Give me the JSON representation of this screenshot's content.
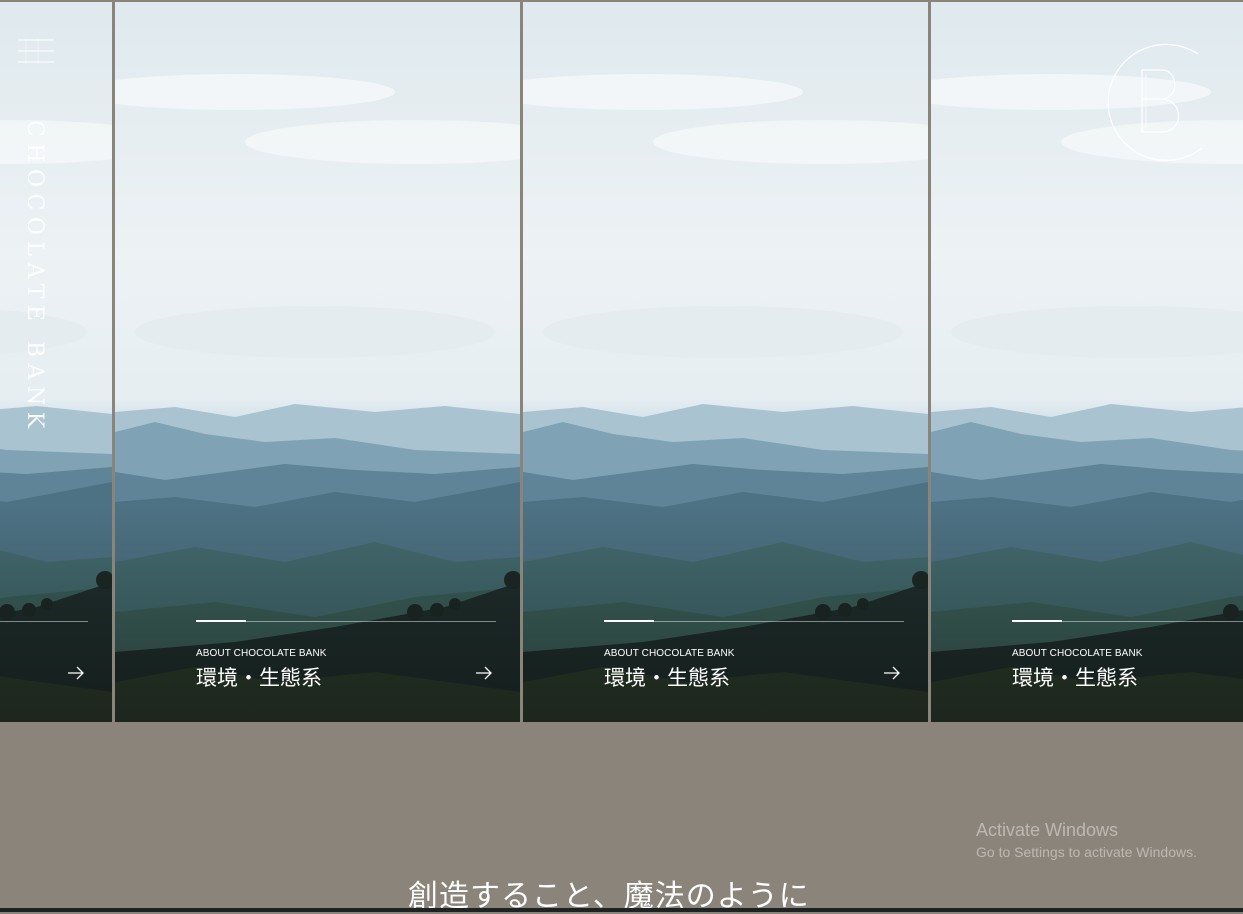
{
  "brand": {
    "vertical_name": "CHOCOLATE BANK",
    "logo_letters": "CB"
  },
  "menu": {
    "icon": "hamburger-menu-icon"
  },
  "slides": [
    {
      "kicker": "",
      "title": "",
      "arrow_icon": "arrow-right-icon"
    },
    {
      "kicker": "ABOUT CHOCOLATE BANK",
      "title": "環境・生態系",
      "arrow_icon": "arrow-right-icon"
    },
    {
      "kicker": "ABOUT CHOCOLATE BANK",
      "title": "環境・生態系",
      "arrow_icon": "arrow-right-icon"
    },
    {
      "kicker": "ABOUT CHOCOLATE BANK",
      "title": "環境・生態系",
      "arrow_icon": "arrow-right-icon"
    }
  ],
  "tagline": "創造すること、魔法のように",
  "os_watermark": {
    "line1": "Activate Windows",
    "line2": "Go to Settings to activate Windows."
  },
  "colors": {
    "page_background": "#8b847a",
    "text": "#ffffff"
  }
}
